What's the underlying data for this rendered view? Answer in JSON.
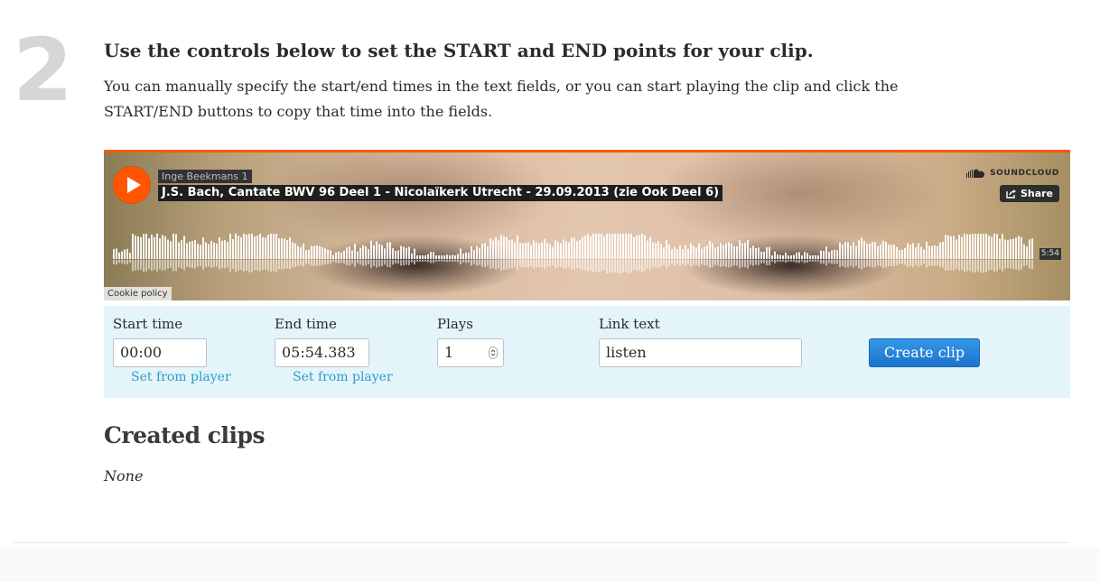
{
  "step": {
    "number": "2"
  },
  "instructions": {
    "heading": "Use the controls below to set the START and END points for your clip.",
    "line1": "You can manually specify the start/end times in the text fields, or you can start playing the clip and click the",
    "line2": "START/END buttons to copy that time into the fields."
  },
  "player": {
    "artist": "Inge Beekmans 1",
    "track_title": "J.S. Bach, Cantate BWV 96 Deel 1 - Nicolaïkerk Utrecht - 29.09.2013 (zie Ook Deel 6)",
    "brand": "SOUNDCLOUD",
    "share_label": "Share",
    "duration": "5:54",
    "cookie_label": "Cookie policy",
    "accent_color": "#ff5500",
    "play_icon": "play-icon"
  },
  "controls": {
    "start": {
      "label": "Start time",
      "value": "00:00",
      "link": "Set from player"
    },
    "end": {
      "label": "End time",
      "value": "05:54.383",
      "link": "Set from player"
    },
    "plays": {
      "label": "Plays",
      "value": "1"
    },
    "link_text": {
      "label": "Link text",
      "value": "listen"
    },
    "create_label": "Create clip",
    "panel_color": "#e3f4fb",
    "button_color": "#1f7bd4"
  },
  "created": {
    "heading": "Created clips",
    "empty_text": "None"
  }
}
